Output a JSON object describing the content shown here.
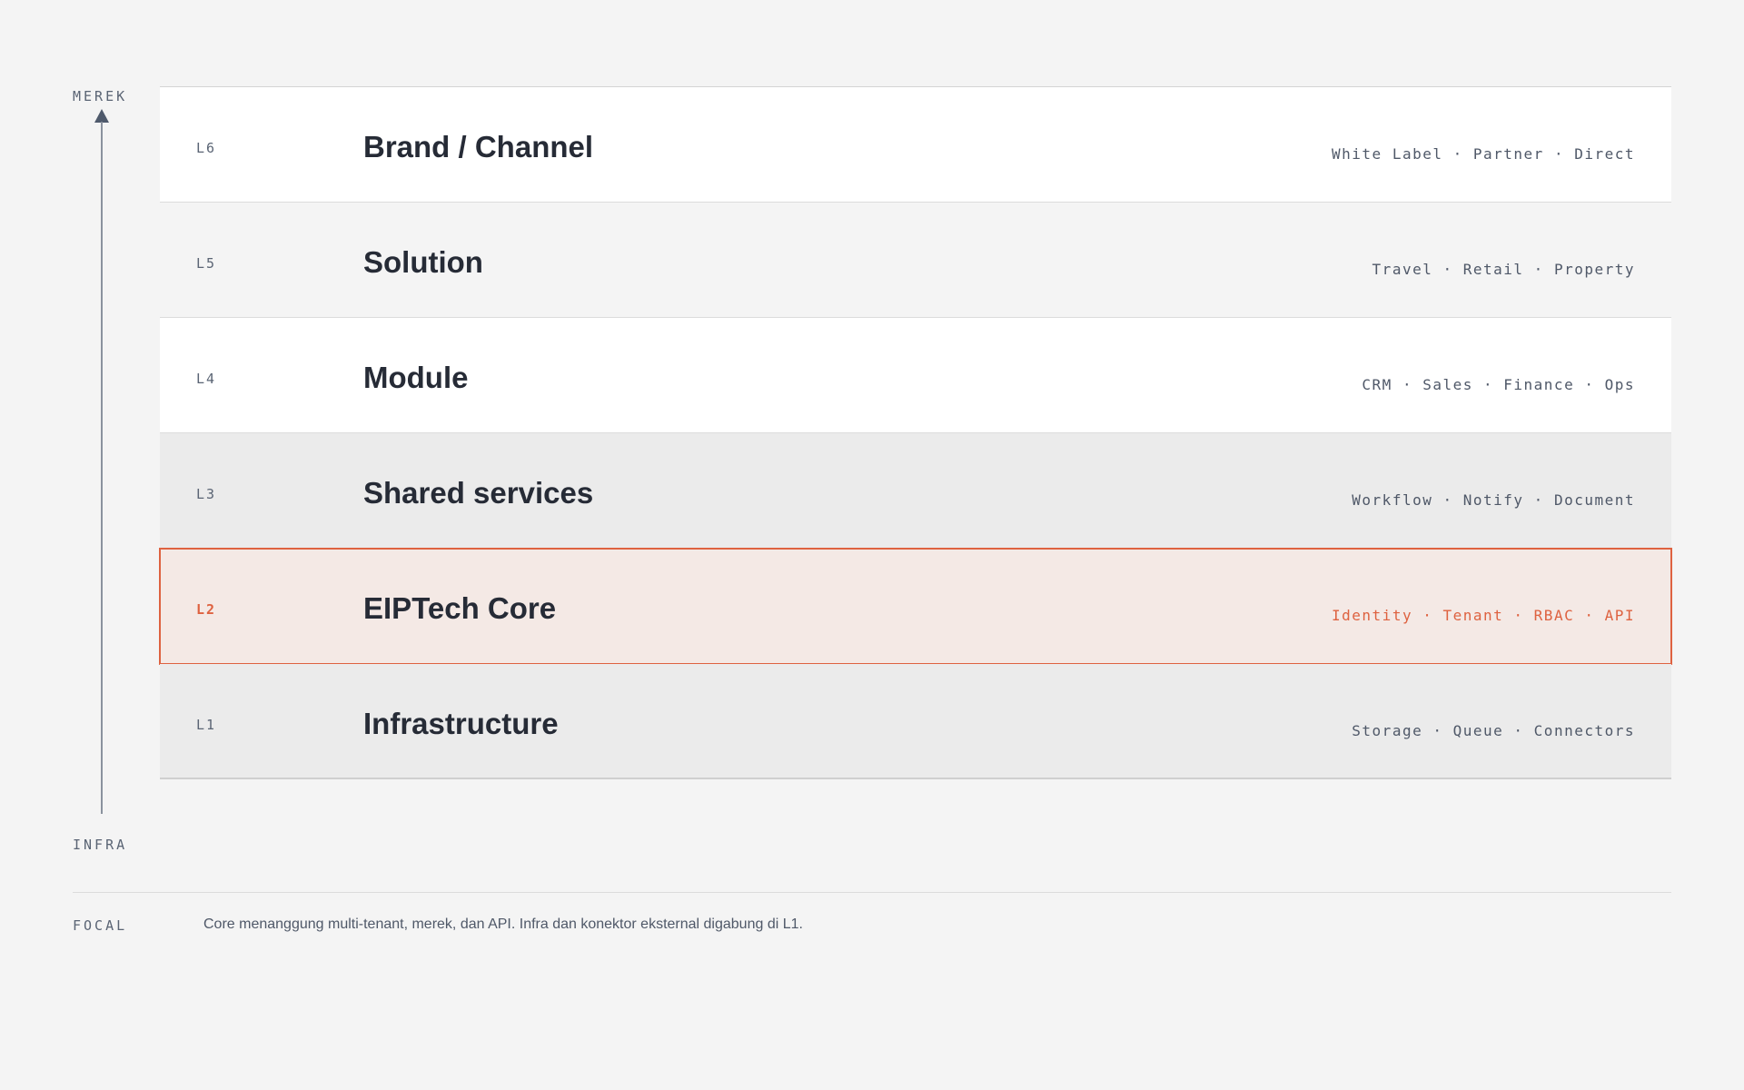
{
  "axis": {
    "top_label": "MEREK",
    "bottom_label": "INFRA"
  },
  "layers": [
    {
      "code": "L6",
      "title": "Brand / Channel",
      "tags": "White Label · Partner · Direct",
      "style": "white"
    },
    {
      "code": "L5",
      "title": "Solution",
      "tags": "Travel · Retail · Property",
      "style": "light"
    },
    {
      "code": "L4",
      "title": "Module",
      "tags": "CRM · Sales · Finance · Ops",
      "style": "white"
    },
    {
      "code": "L3",
      "title": "Shared services",
      "tags": "Workflow · Notify · Document",
      "style": "grey"
    },
    {
      "code": "L2",
      "title": "EIPTech Core",
      "tags": "Identity · Tenant · RBAC · API",
      "style": "focal"
    },
    {
      "code": "L1",
      "title": "Infrastructure",
      "tags": "Storage · Queue · Connectors",
      "style": "grey"
    }
  ],
  "footer": {
    "label": "FOCAL",
    "note": "Core menanggung multi-tenant, merek, dan API. Infra dan konektor eksternal digabung di L1."
  },
  "colors": {
    "focal_accent": "#de6240",
    "text_dark": "#262b36",
    "text_muted": "#5a6474"
  }
}
